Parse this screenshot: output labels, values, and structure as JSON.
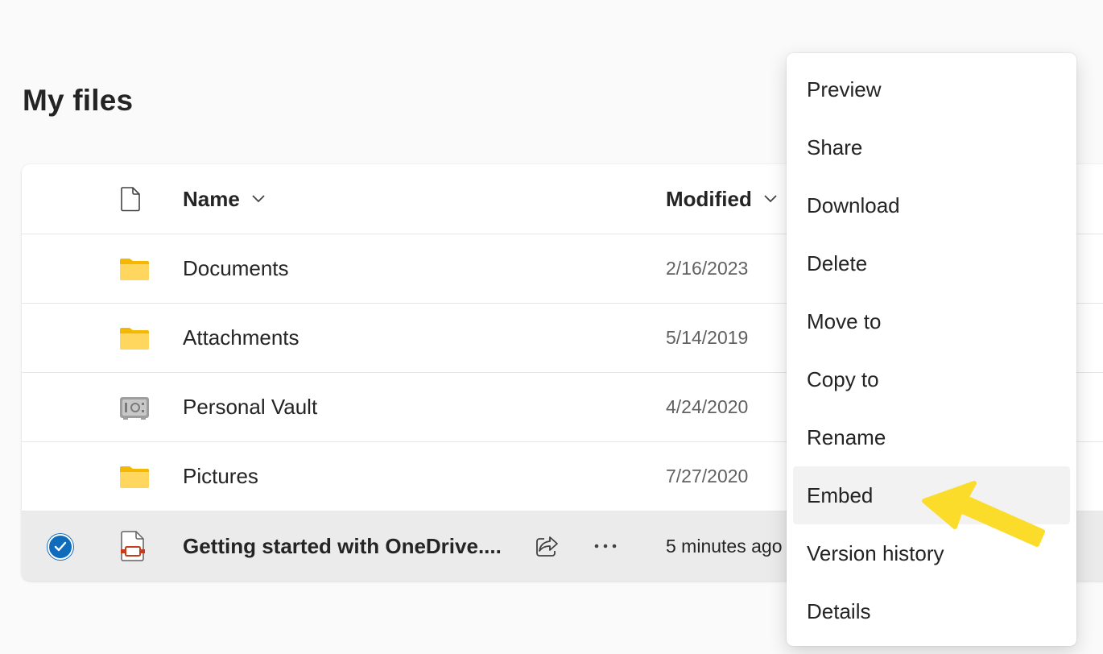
{
  "page": {
    "title": "My files"
  },
  "table": {
    "headers": {
      "name": "Name",
      "modified": "Modified"
    },
    "rows": [
      {
        "icon": "folder-icon",
        "name": "Documents",
        "modified": "2/16/2023"
      },
      {
        "icon": "folder-icon",
        "name": "Attachments",
        "modified": "5/14/2019"
      },
      {
        "icon": "vault-icon",
        "name": "Personal Vault",
        "modified": "4/24/2020"
      },
      {
        "icon": "folder-icon",
        "name": "Pictures",
        "modified": "7/27/2020"
      },
      {
        "icon": "powerpoint-file-icon",
        "name": "Getting started with OneDrive....",
        "modified": "5 minutes ago",
        "selected": true
      }
    ]
  },
  "context_menu": {
    "items": [
      {
        "label": "Preview"
      },
      {
        "label": "Share"
      },
      {
        "label": "Download"
      },
      {
        "label": "Delete"
      },
      {
        "label": "Move to"
      },
      {
        "label": "Copy to"
      },
      {
        "label": "Rename"
      },
      {
        "label": "Embed",
        "highlighted": true
      },
      {
        "label": "Version history"
      },
      {
        "label": "Details"
      }
    ]
  },
  "colors": {
    "accent": "#0f6cbd",
    "folder": "#ffd75e",
    "annotation_arrow": "#fcdc2a"
  }
}
